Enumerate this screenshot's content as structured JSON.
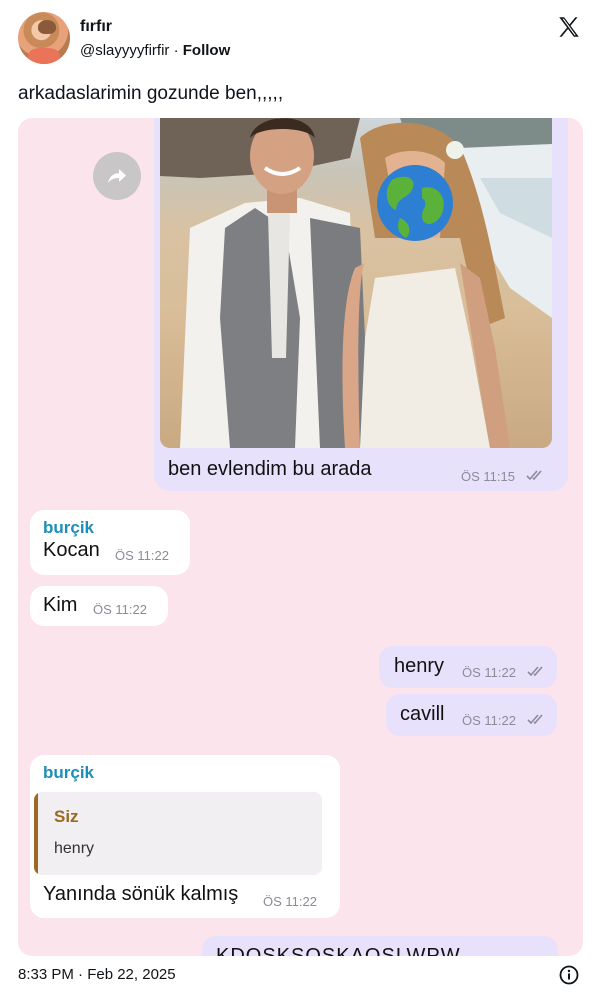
{
  "tweet": {
    "display_name": "fırfır",
    "handle": "@slayyyyfirfir",
    "follow_label": "Follow",
    "text": "arkadaslarimin gozunde ben,,,,,",
    "timestamp": "8:33 PM · Feb 22, 2025"
  },
  "chat": {
    "photo_caption": "ben evlendim bu arada",
    "photo_time": "ÖS 11:15",
    "messages": [
      {
        "sender": "burçik",
        "text": "Kocan",
        "time": "ÖS 11:22"
      },
      {
        "text": "Kim",
        "time": "ÖS 11:22"
      },
      {
        "text": "henry",
        "time": "ÖS 11:22"
      },
      {
        "text": "cavill",
        "time": "ÖS 11:22"
      },
      {
        "sender": "burçik",
        "quote_name": "Siz",
        "quote_text": "henry",
        "text": "Yanında sönük kalmış",
        "time": "ÖS 11:22"
      },
      {
        "text": "KDOSKSOSKAOSLWPW"
      }
    ]
  },
  "icons": {
    "x_logo": "x-logo-icon",
    "share": "share-forward-icon",
    "info": "info-icon",
    "ticks": "double-check-icon",
    "face_cover": "globe-emoji-icon"
  },
  "colors": {
    "chat_background": "#fce4ec",
    "outgoing_bubble": "#e7e1fb",
    "incoming_bubble": "#ffffff",
    "sender_name": "#1b8fb8",
    "quote_accent": "#9b6a1f"
  }
}
